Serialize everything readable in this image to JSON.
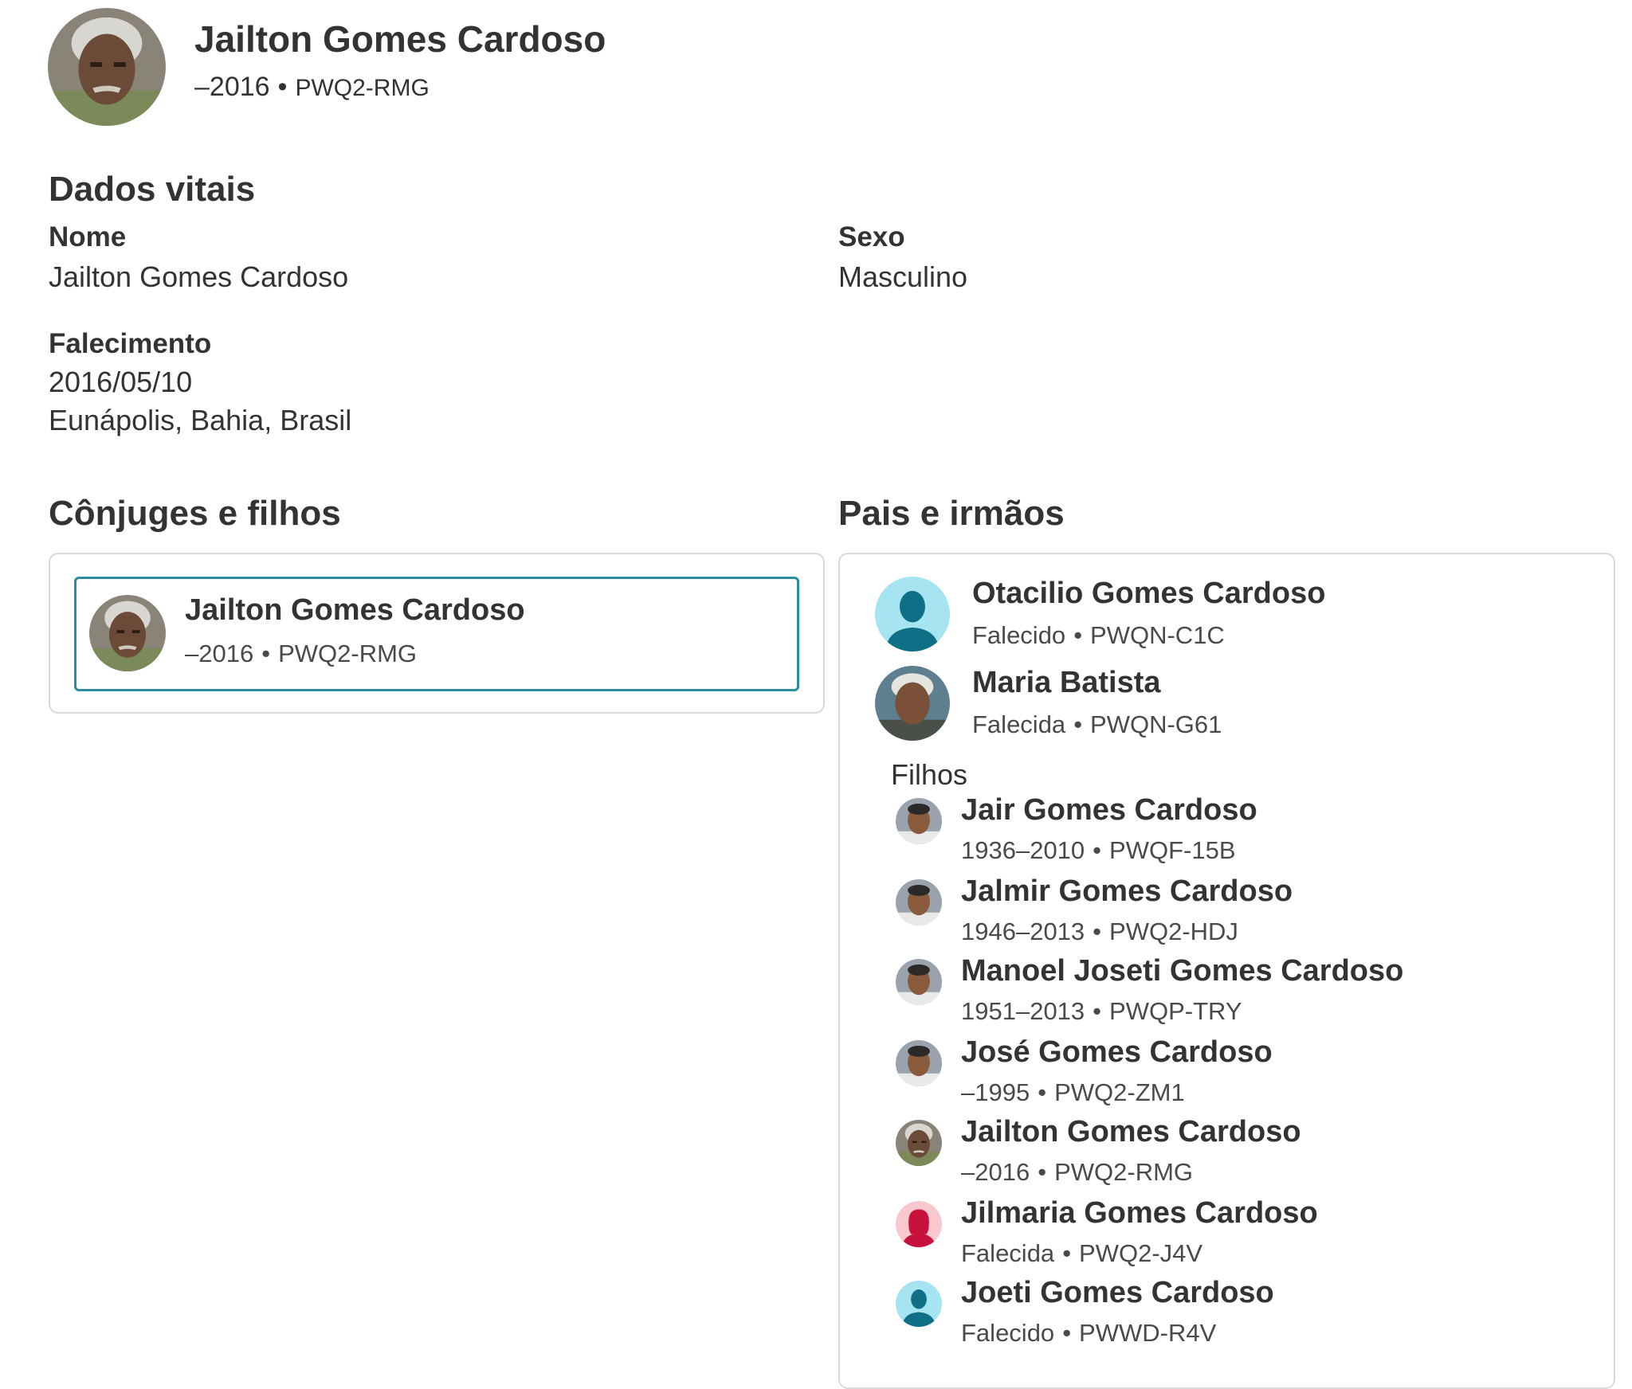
{
  "person": {
    "name": "Jailton Gomes Cardoso",
    "lifespan": "–2016",
    "pid": "PWQ2-RMG"
  },
  "vitals": {
    "title": "Dados vitais",
    "name_label": "Nome",
    "name_value": "Jailton Gomes Cardoso",
    "sex_label": "Sexo",
    "sex_value": "Masculino",
    "death_label": "Falecimento",
    "death_date": "2016/05/10",
    "death_place": "Eunápolis, Bahia, Brasil"
  },
  "spouses": {
    "title": "Cônjuges e filhos",
    "people": [
      {
        "name": "Jailton Gomes Cardoso",
        "lifespan": "–2016",
        "pid": "PWQ2-RMG",
        "avatar": "photo-man-gray-hair"
      }
    ]
  },
  "parents": {
    "title": "Pais e irmãos",
    "people": [
      {
        "name": "Otacilio Gomes Cardoso",
        "lifespan": "Falecido",
        "pid": "PWQN-C1C",
        "avatar": "male-silhouette-icon"
      },
      {
        "name": "Maria Batista",
        "lifespan": "Falecida",
        "pid": "PWQN-G61",
        "avatar": "photo-elderly-woman"
      }
    ],
    "children_label": "Filhos",
    "children": [
      {
        "name": "Jair Gomes Cardoso",
        "lifespan": "1936–2010",
        "pid": "PWQF-15B",
        "avatar": "photo-man"
      },
      {
        "name": "Jalmir Gomes Cardoso",
        "lifespan": "1946–2013",
        "pid": "PWQ2-HDJ",
        "avatar": "photo-man"
      },
      {
        "name": "Manoel Joseti Gomes Cardoso",
        "lifespan": "1951–2013",
        "pid": "PWQP-TRY",
        "avatar": "photo-man"
      },
      {
        "name": "José Gomes Cardoso",
        "lifespan": "–1995",
        "pid": "PWQ2-ZM1",
        "avatar": "photo-man"
      },
      {
        "name": "Jailton Gomes Cardoso",
        "lifespan": "–2016",
        "pid": "PWQ2-RMG",
        "avatar": "photo-man-gray-hair"
      },
      {
        "name": "Jilmaria Gomes Cardoso",
        "lifespan": "Falecida",
        "pid": "PWQ2-J4V",
        "avatar": "female-silhouette-icon"
      },
      {
        "name": "Joeti Gomes Cardoso",
        "lifespan": "Falecido",
        "pid": "PWWD-R4V",
        "avatar": "male-silhouette-icon"
      }
    ]
  },
  "colors": {
    "text": "#333331",
    "selected_border": "#2b8ea0",
    "card_border": "#d9d9d9",
    "male_icon_bg": "#a6e4f2",
    "male_icon_fg": "#0f6f86",
    "female_icon_bg": "#f9c8cf",
    "female_icon_fg": "#c8123e"
  }
}
